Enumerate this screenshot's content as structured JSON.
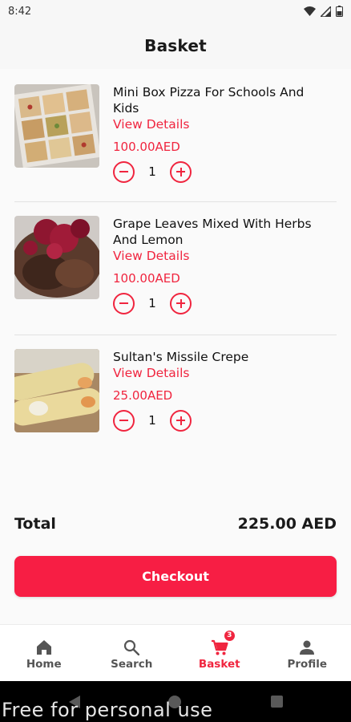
{
  "status_bar": {
    "time": "8:42"
  },
  "header": {
    "title": "Basket"
  },
  "items": [
    {
      "name": "Mini Box Pizza For Schools And Kids",
      "link": "View Details",
      "price": "100.00AED",
      "quantity": "1",
      "thumb": "mini-box-pizza-photo"
    },
    {
      "name": "Grape Leaves Mixed With Herbs And Lemon",
      "link": "View Details",
      "price": "100.00AED",
      "quantity": "1",
      "thumb": "grape-leaves-photo"
    },
    {
      "name": "Sultan's Missile Crepe",
      "link": "View Details",
      "price": "25.00AED",
      "quantity": "1",
      "thumb": "crepe-photo"
    }
  ],
  "summary": {
    "total_label": "Total",
    "total_value": "225.00 AED"
  },
  "checkout": {
    "label": "Checkout"
  },
  "nav": {
    "items": [
      {
        "label": "Home",
        "icon": "home-icon"
      },
      {
        "label": "Search",
        "icon": "search-icon"
      },
      {
        "label": "Basket",
        "icon": "cart-icon",
        "badge": "3"
      },
      {
        "label": "Profile",
        "icon": "person-icon"
      }
    ],
    "active": "Basket"
  },
  "watermark": "Free for personal use",
  "colors": {
    "accent": "#f0253f",
    "checkout": "#f71e44",
    "text": "#111111",
    "background": "#fafafa"
  }
}
